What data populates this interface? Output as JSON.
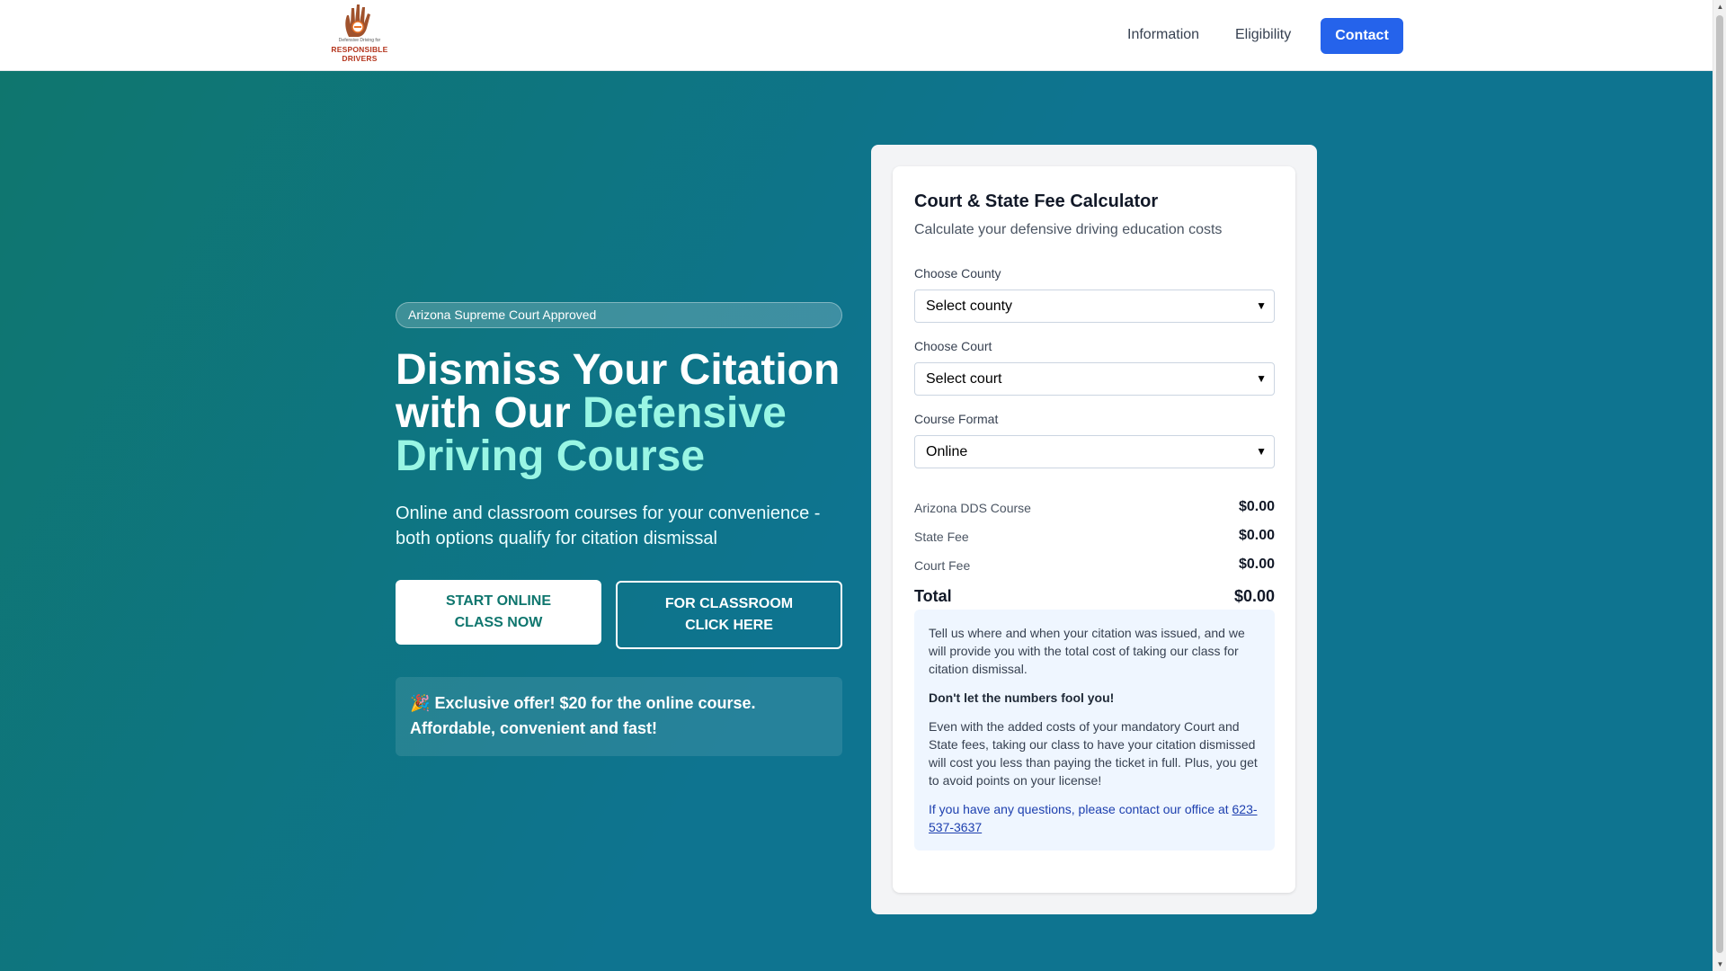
{
  "header": {
    "logo": {
      "tagline": "Defensive Driving for",
      "brand": "RESPONSIBLE DRIVERS",
      "icon": "hand-logo-icon"
    },
    "nav": {
      "information": "Information",
      "eligibility": "Eligibility",
      "contact": "Contact"
    }
  },
  "hero": {
    "badge": "Arizona Supreme Court Approved",
    "headline_part1": "Dismiss Your Citation with Our ",
    "headline_accent": "Defensive Driving Course",
    "subtitle": "Online and classroom courses for your convenience - both options qualify for citation dismissal",
    "btn_online_line1": "START ONLINE",
    "btn_online_line2": "CLASS NOW",
    "btn_class_line1": "FOR CLASSROOM",
    "btn_class_line2": "CLICK HERE",
    "offer_emoji": "🎉",
    "offer_text": "Exclusive offer! $20 for the online course. Affordable, convenient and fast!"
  },
  "calculator": {
    "title": "Court & State Fee Calculator",
    "subtitle": "Calculate your defensive driving education costs",
    "county_label": "Choose County",
    "county_value": "Select county",
    "court_label": "Choose Court",
    "court_value": "Select court",
    "format_label": "Course Format",
    "format_value": "Online",
    "rows": [
      {
        "label": "Arizona DDS Course",
        "amount": "$0.00"
      },
      {
        "label": "State Fee",
        "amount": "$0.00"
      },
      {
        "label": "Court Fee",
        "amount": "$0.00"
      }
    ],
    "total_label": "Total",
    "total_amount": "$0.00",
    "info": {
      "p1": "Tell us where and when your citation was issued, and we will provide you with the total cost of taking our class for citation dismissal.",
      "p2": "Don't let the numbers fool you!",
      "p3": "Even with the added costs of your mandatory Court and State fees, taking our class to have your citation dismissed will cost you less than paying the ticket in full. Plus, you get to avoid points on your license!",
      "contact_prefix": "If you have any questions, please contact our office at ",
      "phone": "623-537-3637"
    }
  },
  "colors": {
    "primary": "#2563eb",
    "hero_start": "#0f766e",
    "hero_end": "#0e7490",
    "accent_text": "#99f6e4",
    "brand_red": "#b4351d"
  }
}
